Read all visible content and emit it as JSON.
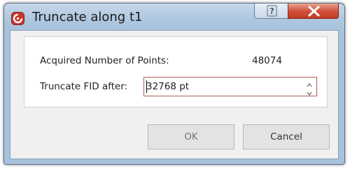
{
  "window": {
    "title": "Truncate along t1",
    "icon": "app-logo-icon",
    "help_icon": "help-icon",
    "close_icon": "close-icon"
  },
  "form": {
    "acquired_label": "Acquired Number of Points:",
    "acquired_value": "48074",
    "truncate_label": "Truncate FID after:",
    "truncate_value": "32768 pt"
  },
  "buttons": {
    "ok": "OK",
    "cancel": "Cancel"
  },
  "colors": {
    "accent": "#c53b22",
    "frame": "#a7c2dc",
    "field_border": "#b55a56"
  }
}
